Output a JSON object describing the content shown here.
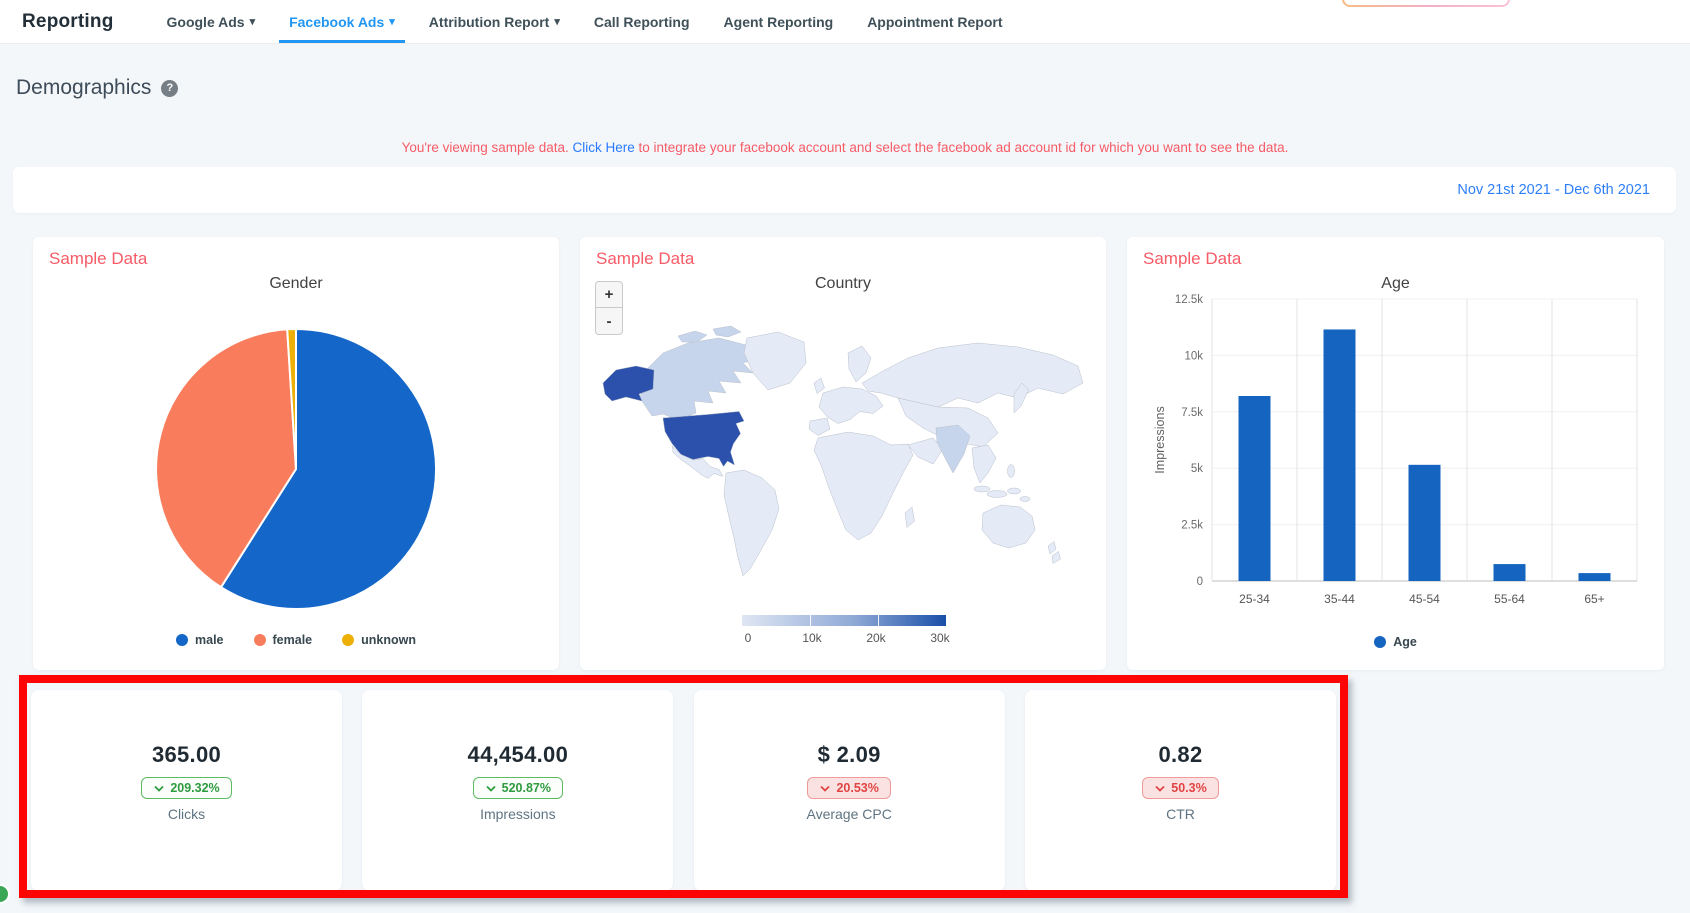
{
  "colors": {
    "accent_blue": "#2196f3",
    "link_blue": "#2979ff",
    "date_blue": "#2d7ff9",
    "sample_red": "#f65b66",
    "annotation_red": "#fe0505",
    "bar_blue": "#1565c0",
    "map_land": "#e4eaf6",
    "map_mid": "#c7d5ec",
    "map_high": "#2b51ad",
    "scale_min": "#dfe6f3",
    "scale_max": "#1a4fa8",
    "badge_green": "#2e9b3e",
    "badge_red": "#e04444",
    "chat_green": "#3aa757"
  },
  "nav": {
    "title": "Reporting",
    "items": [
      {
        "label": "Google Ads",
        "caret": true,
        "active": false
      },
      {
        "label": "Facebook Ads",
        "caret": true,
        "active": true
      },
      {
        "label": "Attribution Report",
        "caret": true,
        "active": false
      },
      {
        "label": "Call Reporting",
        "caret": false,
        "active": false
      },
      {
        "label": "Agent Reporting",
        "caret": false,
        "active": false
      },
      {
        "label": "Appointment Report",
        "caret": false,
        "active": false
      }
    ]
  },
  "page": {
    "heading": "Demographics",
    "help_icon": "?",
    "notice_prefix": "You're viewing sample data. ",
    "notice_link": "Click Here",
    "notice_suffix": " to integrate your facebook account and select the facebook ad account id for which you want to see the data.",
    "date_range": "Nov 21st 2021 - Dec 6th 2021",
    "sample_label": "Sample Data"
  },
  "country_card": {
    "zoom_in": "+",
    "zoom_out": "-"
  },
  "chart_data": [
    {
      "type": "pie",
      "title": "Gender",
      "labels": [
        "male",
        "female",
        "unknown"
      ],
      "values": [
        59,
        40,
        1
      ],
      "values_note": "percent estimates read from slice angles",
      "colors": [
        "#1467c8",
        "#f97d5c",
        "#edb009"
      ],
      "legend_position": "bottom"
    },
    {
      "type": "heatmap",
      "subtype": "world-choropleth",
      "title": "Country",
      "scale": {
        "min": 0,
        "max": 30000,
        "tick_labels": [
          "0",
          "10k",
          "20k",
          "30k"
        ],
        "min_color": "#dfe6f3",
        "max_color": "#1a4fa8"
      },
      "highlighted_regions": [
        {
          "region": "United States",
          "shade": "darkest",
          "value_estimate": 30000
        },
        {
          "region": "Canada",
          "shade": "medium",
          "value_estimate": 5000
        },
        {
          "region": "India",
          "shade": "medium",
          "value_estimate": 4000
        }
      ],
      "controls": [
        "zoom-in",
        "zoom-out"
      ]
    },
    {
      "type": "bar",
      "title": "Age",
      "xlabel": "",
      "ylabel": "Impressions",
      "categories": [
        "25-34",
        "35-44",
        "45-54",
        "55-64",
        "65+"
      ],
      "values": [
        8200,
        11150,
        5150,
        750,
        350
      ],
      "ylim": [
        0,
        12500
      ],
      "ytick_labels": [
        "0",
        "2.5k",
        "5k",
        "7.5k",
        "10k",
        "12.5k"
      ],
      "bar_color": "#1565c0",
      "legend": "Age",
      "legend_position": "bottom",
      "grid": true
    }
  ],
  "kpi": {
    "cards": [
      {
        "value": "365.00",
        "change": "209.32%",
        "direction": "down",
        "trend_color": "green",
        "label": "Clicks"
      },
      {
        "value": "44,454.00",
        "change": "520.87%",
        "direction": "down",
        "trend_color": "green",
        "label": "Impressions"
      },
      {
        "value": "$ 2.09",
        "change": "20.53%",
        "direction": "down",
        "trend_color": "red",
        "label": "Average CPC"
      },
      {
        "value": "0.82",
        "change": "50.3%",
        "direction": "down",
        "trend_color": "red",
        "label": "CTR"
      }
    ]
  }
}
